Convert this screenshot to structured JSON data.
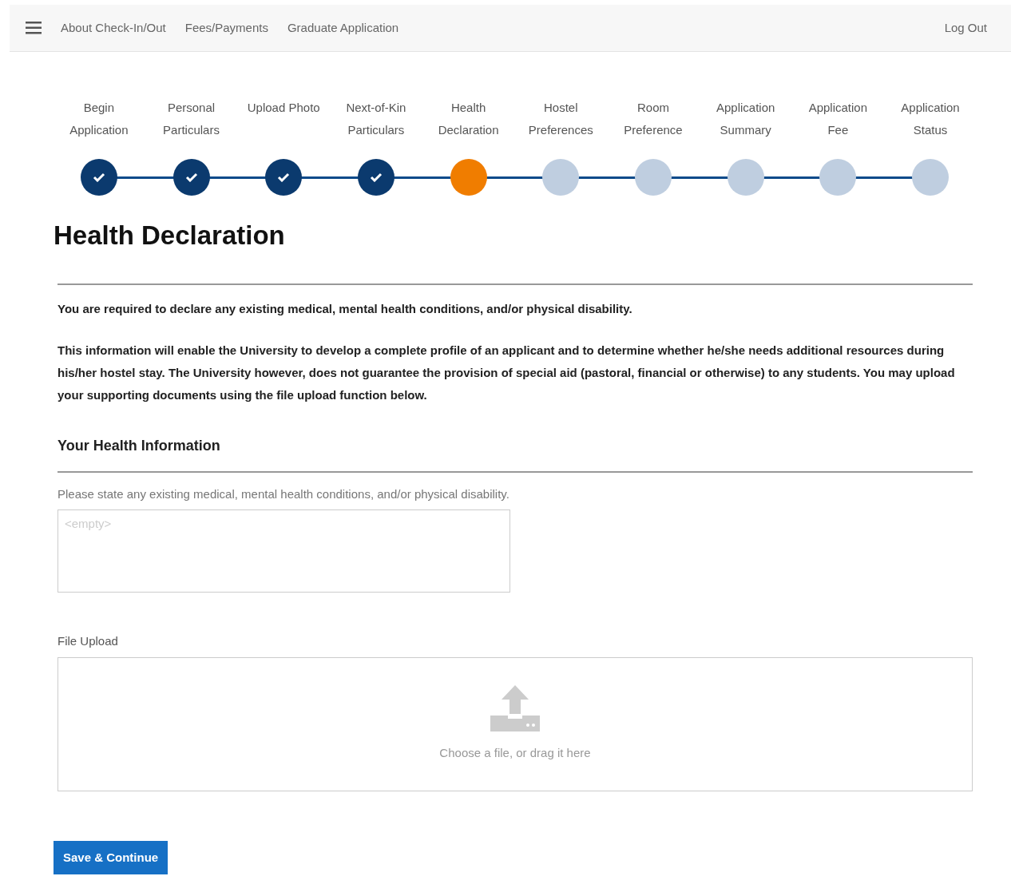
{
  "navbar": {
    "links": [
      "About Check-In/Out",
      "Fees/Payments",
      "Graduate Application"
    ],
    "logout": "Log Out"
  },
  "steps": [
    {
      "label": "Begin Application",
      "completed": true,
      "selected": false
    },
    {
      "label": "Personal Particulars",
      "completed": true,
      "selected": false
    },
    {
      "label": "Upload Photo",
      "completed": true,
      "selected": false
    },
    {
      "label": "Next-of-Kin Particulars",
      "completed": true,
      "selected": false
    },
    {
      "label": "Health Declaration",
      "completed": false,
      "selected": true
    },
    {
      "label": "Hostel Preferences",
      "completed": false,
      "selected": false
    },
    {
      "label": "Room Preference",
      "completed": false,
      "selected": false
    },
    {
      "label": "Application Summary",
      "completed": false,
      "selected": false
    },
    {
      "label": "Application Fee",
      "completed": false,
      "selected": false
    },
    {
      "label": "Application Status",
      "completed": false,
      "selected": false
    }
  ],
  "title": "Health Declaration",
  "paragraphs": [
    "You are required to declare any existing medical, mental health conditions, and/or physical disability.",
    "This information will enable the University to develop a complete profile of an applicant and to determine whether he/she needs additional resources during his/her hostel stay. The University however, does not guarantee the provision of special aid (pastoral, financial or otherwise) to any students. You may upload your supporting documents using the file upload function below."
  ],
  "section_title": "Your Health Information",
  "health_field": {
    "label": "Please state any existing medical, mental health conditions, and/or physical disability.",
    "placeholder": "<empty>"
  },
  "file_upload": {
    "label": "File Upload",
    "hint": "Choose a file, or drag it here"
  },
  "save_button": "Save & Continue"
}
